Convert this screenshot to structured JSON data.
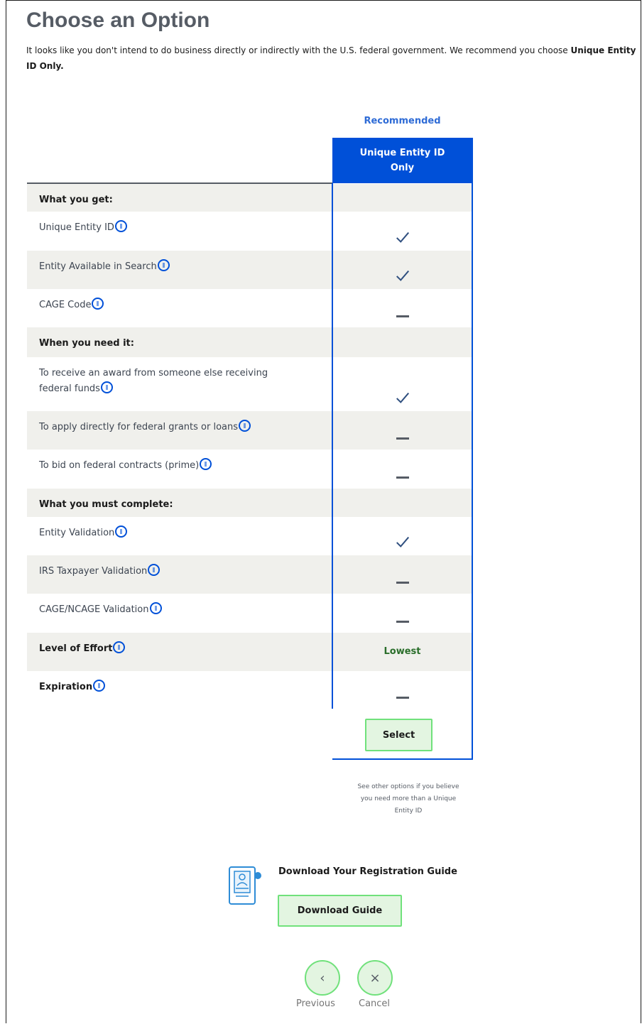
{
  "page": {
    "title": "Choose an Option",
    "intro_text": "It looks like you don't intend to do business directly or indirectly with the U.S. federal government. We recommend you choose ",
    "intro_bold": "Unique Entity ID Only."
  },
  "table": {
    "recommended_label": "Recommended",
    "column_header": "Unique Entity ID Only",
    "rows": [
      {
        "label": "What you get:",
        "kind": "section"
      },
      {
        "label": "Unique Entity ID",
        "info": true,
        "value": "check"
      },
      {
        "label": "Entity Available in Search",
        "info": true,
        "value": "check"
      },
      {
        "label": "CAGE Code",
        "info": true,
        "value": "dash"
      },
      {
        "label": "When you need it:",
        "kind": "section"
      },
      {
        "label": "To receive an award from someone else receiving federal funds",
        "info": true,
        "value": "check"
      },
      {
        "label": "To apply directly for federal grants or loans",
        "info": true,
        "value": "dash"
      },
      {
        "label": "To bid on federal contracts (prime)",
        "info": true,
        "value": "dash"
      },
      {
        "label": "What you must complete:",
        "kind": "section"
      },
      {
        "label": "Entity Validation",
        "info": true,
        "value": "check"
      },
      {
        "label": "IRS Taxpayer Validation",
        "info": true,
        "value": "dash"
      },
      {
        "label": "CAGE/NCAGE Validation",
        "info": true,
        "value": "dash"
      },
      {
        "label": "Level of Effort",
        "info": true,
        "bold": true,
        "value": "Lowest"
      },
      {
        "label": "Expiration",
        "info": true,
        "bold": true,
        "value": "dash"
      }
    ],
    "select_label": "Select",
    "see_other_text": "See other options if you believe you need more than a Unique Entity ID"
  },
  "guide": {
    "title": "Download Your Registration Guide",
    "button_label": "Download Guide"
  },
  "nav": {
    "previous_label": "Previous",
    "cancel_label": "Cancel",
    "previous_icon": "‹",
    "cancel_icon": "×"
  },
  "colors": {
    "primary_blue": "#0050d8",
    "green_button_bg": "#e3f5e1",
    "green_button_border": "#70e17b",
    "row_shade": "#f0f0ec"
  }
}
